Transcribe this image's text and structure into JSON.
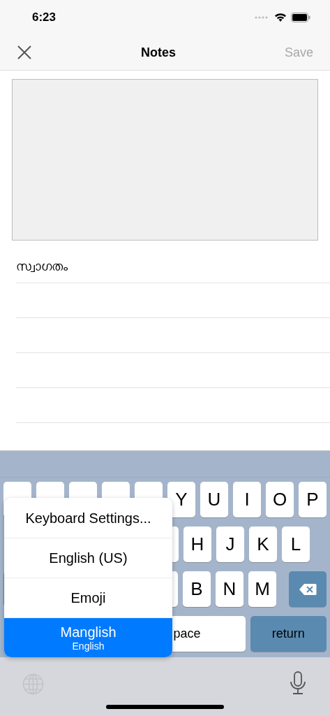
{
  "status_bar": {
    "time": "6:23"
  },
  "nav": {
    "title": "Notes",
    "save": {
      "label": "Save",
      "disabled": true
    }
  },
  "note_lines": [
    "സ്വാഗതം"
  ],
  "keyboard": {
    "row1": [
      "Y",
      "U",
      "I",
      "O",
      "P"
    ],
    "row2": [
      "H",
      "J",
      "K",
      "L"
    ],
    "row3": [
      "B",
      "N",
      "M"
    ],
    "space": "pace",
    "return": "return"
  },
  "language_menu": [
    {
      "label": "Keyboard Settings...",
      "selected": false
    },
    {
      "label": "English (US)",
      "selected": false
    },
    {
      "label": "Emoji",
      "selected": false
    },
    {
      "label": "Manglish",
      "sublabel": "English",
      "selected": true
    }
  ]
}
